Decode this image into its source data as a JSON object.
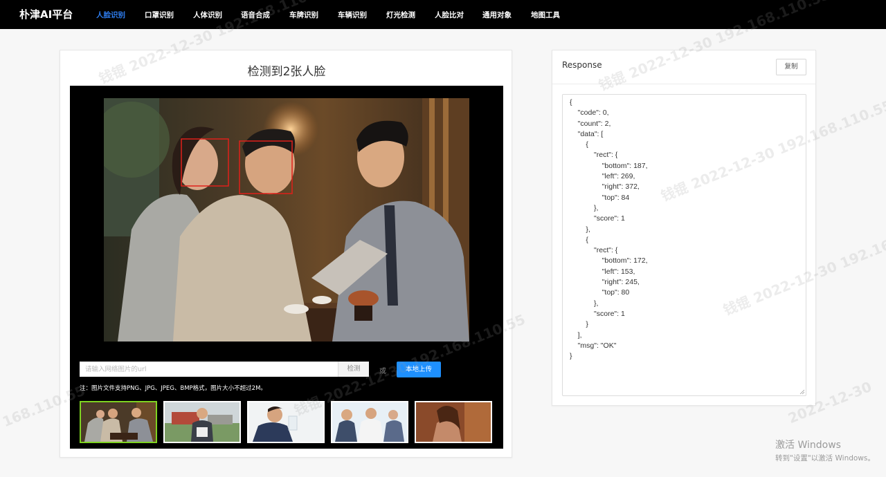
{
  "app": {
    "brand": "朴津AI平台"
  },
  "nav": {
    "items": [
      {
        "label": "人脸识别",
        "active": true
      },
      {
        "label": "口罩识别",
        "active": false
      },
      {
        "label": "人体识别",
        "active": false
      },
      {
        "label": "语音合成",
        "active": false
      },
      {
        "label": "车牌识别",
        "active": false
      },
      {
        "label": "车辆识别",
        "active": false
      },
      {
        "label": "灯光检测",
        "active": false
      },
      {
        "label": "人脸比对",
        "active": false
      },
      {
        "label": "通用对象",
        "active": false
      },
      {
        "label": "地图工具",
        "active": false
      }
    ],
    "active_color": "#2f7ff2"
  },
  "detect": {
    "title": "检测到2张人脸",
    "url_placeholder": "请输入网络图片的url",
    "detect_label": "检测",
    "or_label": "或",
    "upload_label": "本地上传",
    "note": "注：图片文件支持PNG、JPG、JPEG、BMP格式，图片大小不超过2M。",
    "thumbnails": [
      "sample-meeting",
      "sample-man-with-bag",
      "sample-man-drinking",
      "sample-office-team",
      "sample-woman-portrait"
    ],
    "selected_thumbnail": 0,
    "box_color": "#e0201a",
    "upload_color": "#1e90ff"
  },
  "response": {
    "title": "Response",
    "copy_label": "复制",
    "json_text": "{\n    \"code\": 0,\n    \"count\": 2,\n    \"data\": [\n        {\n            \"rect\": {\n                \"bottom\": 187,\n                \"left\": 269,\n                \"right\": 372,\n                \"top\": 84\n            },\n            \"score\": 1\n        },\n        {\n            \"rect\": {\n                \"bottom\": 172,\n                \"left\": 153,\n                \"right\": 245,\n                \"top\": 80\n            },\n            \"score\": 1\n        }\n    ],\n    \"msg\": \"OK\"\n}"
  },
  "watermark": {
    "text_a": "钱锟  2022-12-30  192.168.110.55",
    "text_b": "168.110.55",
    "text_c": "2022-12-30"
  },
  "windows": {
    "title": "激活 Windows",
    "subtitle": "转到\"设置\"以激活 Windows。"
  }
}
